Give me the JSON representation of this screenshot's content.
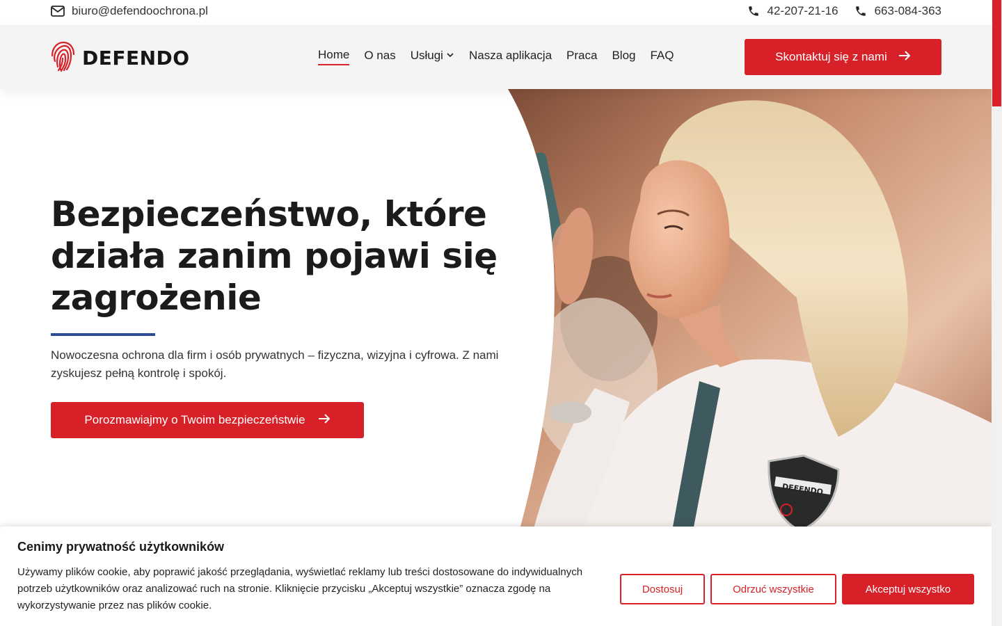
{
  "topbar": {
    "email": "biuro@defendoochrona.pl",
    "phone1": "42-207-21-16",
    "phone2": "663-084-363"
  },
  "header": {
    "logo_text": "DEFENDO",
    "nav": {
      "home": "Home",
      "about": "O nas",
      "services": "Usługi",
      "app": "Nasza aplikacja",
      "jobs": "Praca",
      "blog": "Blog",
      "faq": "FAQ"
    },
    "cta": "Skontaktuj się z nami"
  },
  "hero": {
    "title": "Bezpieczeństwo, które działa zanim pojawi się zagrożenie",
    "subtitle": "Nowoczesna ochrona dla firm i osób prywatnych – fizyczna, wizyjna i cyfrowa. Z nami zyskujesz pełną kontrolę i spokój.",
    "cta": "Porozmawiajmy o Twoim bezpieczeństwie",
    "badge_text": "DEFENDO"
  },
  "cookie": {
    "title": "Cenimy prywatność użytkowników",
    "text": "Używamy plików cookie, aby poprawić jakość przeglądania, wyświetlać reklamy lub treści dostosowane do indywidualnych potrzeb użytkowników oraz analizować ruch na stronie. Kliknięcie przycisku „Akceptuj wszystkie” oznacza zgodę na wykorzystywanie przez nas plików cookie.",
    "customize": "Dostosuj",
    "reject": "Odrzuć wszystkie",
    "accept": "Akceptuj wszystko"
  },
  "colors": {
    "brand_red": "#d72027",
    "accent_blue": "#2e4a9a"
  },
  "icons": [
    "envelope-icon",
    "phone-icon",
    "fingerprint-logo-icon",
    "chevron-down-icon",
    "arrow-right-icon"
  ]
}
